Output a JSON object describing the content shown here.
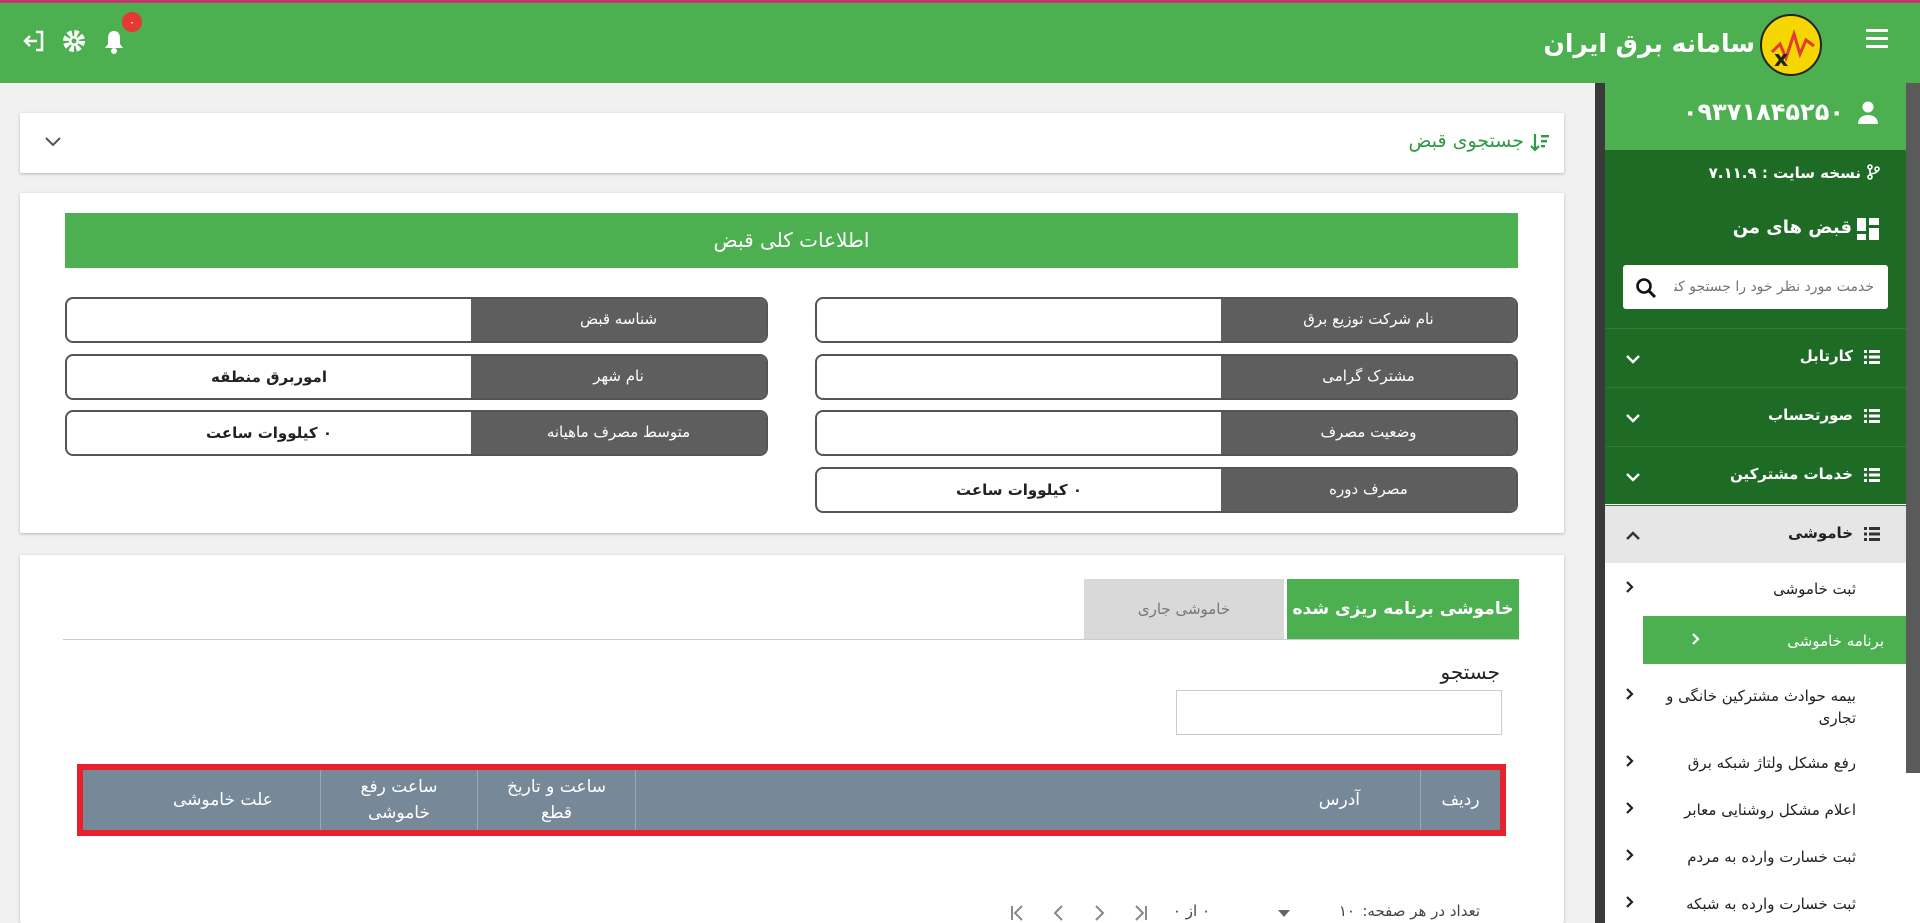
{
  "header": {
    "brand": "سامانه برق ایران",
    "notification_count": "۰",
    "colors": {
      "primary": "#4caf50",
      "dark": "#1d6b24",
      "alert": "#e53935"
    }
  },
  "sidebar": {
    "phone": "۰۹۳۷۱۸۴۵۲۵۰",
    "version": "نسخه سایت : ۷.۱۱.۹",
    "bills_title": "قبض های من",
    "search_placeholder": "خدمت مورد نظر خود را جستجو کنید",
    "sections": [
      {
        "label": "کارتابل"
      },
      {
        "label": "صورتحساب"
      },
      {
        "label": "خدمات مشترکین"
      },
      {
        "label": "خاموشی"
      }
    ],
    "sub_items": [
      {
        "label": "ثبت خاموشی"
      },
      {
        "label": "برنامه خاموشی"
      },
      {
        "label": "بیمه حوادث مشترکین خانگی و تجاری"
      },
      {
        "label": "رفع مشکل ولتاژ شبکه برق"
      },
      {
        "label": "اعلام مشکل روشنایی معابر"
      },
      {
        "label": "ثبت خسارت وارده به مردم"
      },
      {
        "label": "ثبت خسارت وارده به شبکه"
      }
    ]
  },
  "bill_search": {
    "title": "جستجوی قبض"
  },
  "bill_info": {
    "banner": "اطلاعات کلی قبض",
    "fields": {
      "company": {
        "label": "نام شرکت توزیع برق",
        "value": ""
      },
      "bill_id": {
        "label": "شناسه قبض",
        "value": ""
      },
      "customer": {
        "label": "مشترک گرامی",
        "value": ""
      },
      "city": {
        "label": "نام شهر",
        "value": "اموربرق منطقه"
      },
      "consumption_status": {
        "label": "وضعیت مصرف",
        "value": ""
      },
      "avg_monthly": {
        "label": "متوسط مصرف ماهیانه",
        "value": "۰ کیلووات ساعت"
      },
      "period_consumption": {
        "label": "مصرف دوره",
        "value": "۰ کیلووات ساعت"
      }
    }
  },
  "outages": {
    "tabs": {
      "scheduled": "خاموشی برنامه ریزی شده",
      "current": "خاموشی جاری"
    },
    "search_label": "جستجو",
    "columns": {
      "row": "ردیف",
      "address": "آدرس",
      "cut_time_1": "ساعت و تاریخ",
      "cut_time_2": "قطع",
      "restore_time_1": "ساعت رفع",
      "restore_time_2": "خاموشی",
      "cause": "علت خاموشی"
    },
    "pager": {
      "per_page_label": "تعداد در هر صفحه:",
      "per_page_value": "۱۰",
      "range": "۰ از ۰"
    }
  }
}
